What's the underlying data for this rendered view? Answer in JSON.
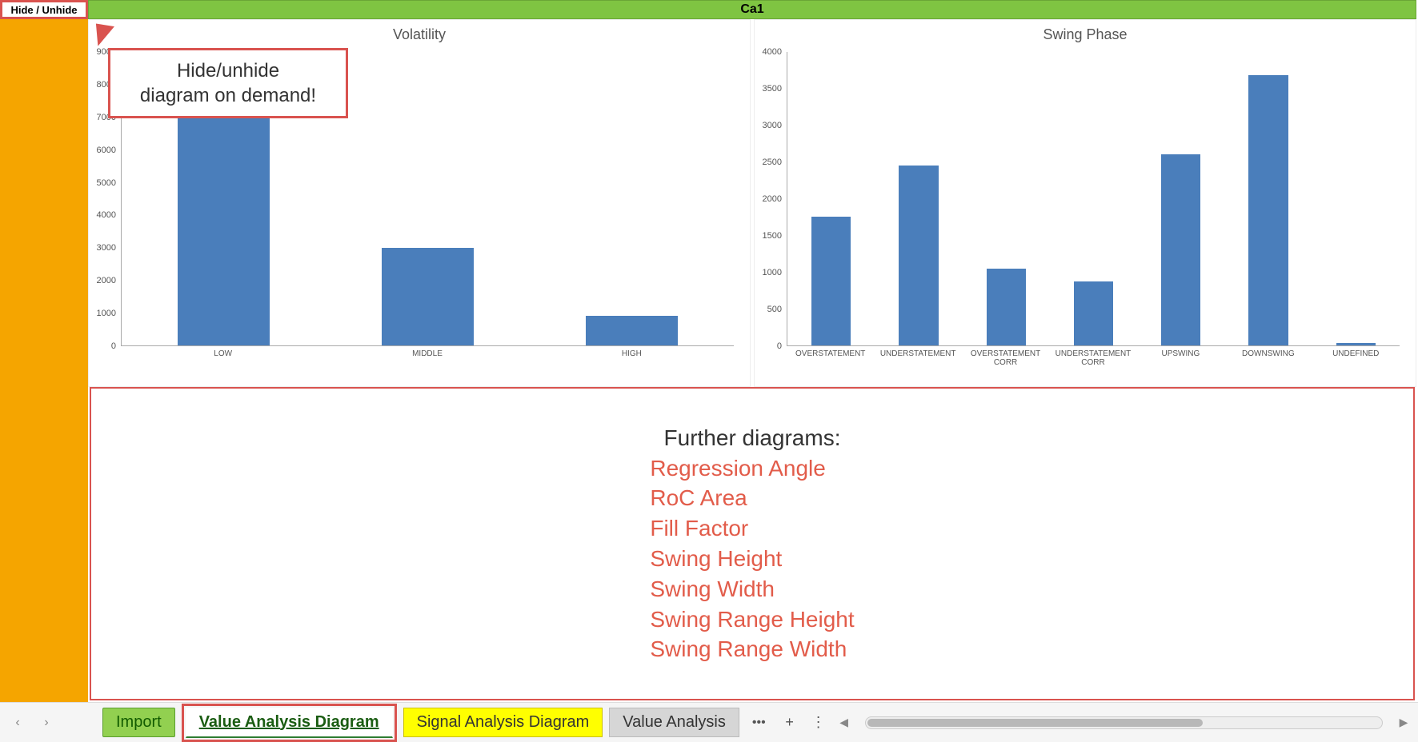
{
  "header": {
    "hide_unhide_label": "Hide / Unhide",
    "title": "Ca1"
  },
  "callout": {
    "line1": "Hide/unhide",
    "line2": "diagram on demand!"
  },
  "chart_data": [
    {
      "type": "bar",
      "title": "Volatility",
      "categories": [
        "LOW",
        "MIDDLE",
        "HIGH"
      ],
      "values": [
        7300,
        3000,
        900
      ],
      "ylim": [
        0,
        9000
      ],
      "yticks": [
        0,
        1000,
        2000,
        3000,
        4000,
        5000,
        6000,
        7000,
        8000,
        9000
      ]
    },
    {
      "type": "bar",
      "title": "Swing Phase",
      "categories": [
        "OVERSTATEMENT",
        "UNDERSTATEMENT",
        "OVERSTATEMENT CORR",
        "UNDERSTATEMENT CORR",
        "UPSWING",
        "DOWNSWING",
        "UNDEFINED"
      ],
      "values": [
        1750,
        2450,
        1050,
        870,
        2600,
        3680,
        30
      ],
      "ylim": [
        0,
        4000
      ],
      "yticks": [
        0,
        500,
        1000,
        1500,
        2000,
        2500,
        3000,
        3500,
        4000
      ]
    }
  ],
  "further": {
    "title": "Further diagrams:",
    "items": [
      "Regression Angle",
      "RoC Area",
      "Fill Factor",
      "Swing Height",
      "Swing Width",
      "Swing Range Height",
      "Swing Range Width"
    ]
  },
  "tabs": {
    "import": "Import",
    "active": "Value Analysis Diagram",
    "yellow": "Signal Analysis Diagram",
    "gray": "Value Analysis",
    "dots": "•••",
    "plus": "+",
    "menu": "⋮"
  }
}
